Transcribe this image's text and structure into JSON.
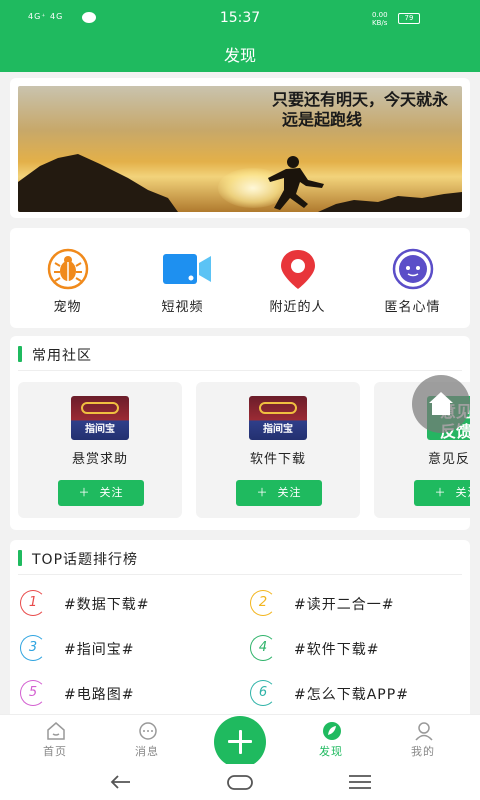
{
  "status_bar": {
    "signal": "4G⁺ 4G",
    "time": "15:37",
    "speed": "0.00\nKB/s",
    "battery": "79"
  },
  "header": {
    "title": "发现"
  },
  "banner": {
    "line1": "只要还有明天，今天就永",
    "line2": "远是起跑线"
  },
  "quick_entries": [
    {
      "label": "宠物",
      "icon": "bug-icon",
      "color": "#f08a1c"
    },
    {
      "label": "短视频",
      "icon": "video-camera-icon",
      "color": "#1e90f0"
    },
    {
      "label": "附近的人",
      "icon": "location-pin-icon",
      "color": "#e8353a"
    },
    {
      "label": "匿名心情",
      "icon": "chat-bubble-icon",
      "color": "#5b4ec8"
    }
  ],
  "community": {
    "title": "常用社区",
    "items": [
      {
        "name": "悬赏求助",
        "logo_text": "指间宝",
        "follow": "关注"
      },
      {
        "name": "软件下载",
        "logo_text": "指间宝",
        "follow": "关注"
      },
      {
        "name": "意见反馈",
        "logo_text": "意见\n反馈",
        "follow": "关注"
      }
    ]
  },
  "top_topics": {
    "title": "TOP话题排行榜",
    "items": [
      {
        "rank": "1",
        "text": "#数据下载#",
        "color": "#e84a4a"
      },
      {
        "rank": "2",
        "text": "#读开二合一#",
        "color": "#f2b51e"
      },
      {
        "rank": "3",
        "text": "#指间宝#",
        "color": "#2fa4e0"
      },
      {
        "rank": "4",
        "text": "#软件下载#",
        "color": "#2fb36a"
      },
      {
        "rank": "5",
        "text": "#电路图#",
        "color": "#d35fd0"
      },
      {
        "rank": "6",
        "text": "#怎么下载APP#",
        "color": "#2fb3a8"
      }
    ]
  },
  "tabbar": {
    "items": [
      {
        "label": "首页",
        "icon": "home-icon"
      },
      {
        "label": "消息",
        "icon": "message-icon"
      },
      {
        "label": "发现",
        "icon": "discover-leaf-icon",
        "active": true
      },
      {
        "label": "我的",
        "icon": "profile-icon"
      }
    ]
  },
  "colors": {
    "brand": "#1fba5f"
  }
}
